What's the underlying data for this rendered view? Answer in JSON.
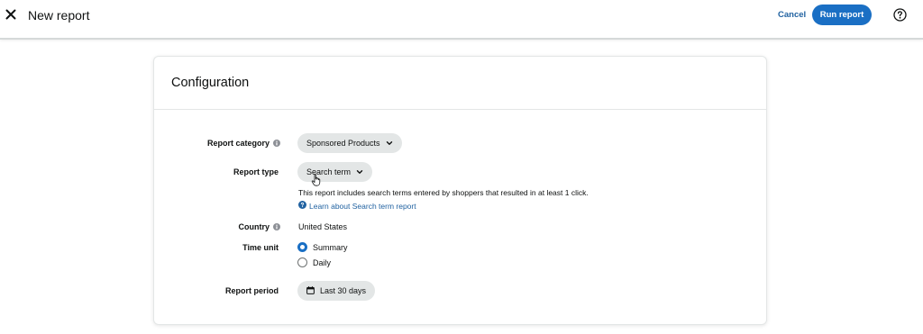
{
  "header": {
    "title": "New report",
    "cancel_label": "Cancel",
    "run_label": "Run report"
  },
  "card": {
    "title": "Configuration"
  },
  "fields": {
    "report_category": {
      "label": "Report category",
      "value": "Sponsored Products"
    },
    "report_type": {
      "label": "Report type",
      "value": "Search term",
      "description": "This report includes search terms entered by shoppers that resulted in at least 1 click.",
      "learn_link": "Learn about Search term report"
    },
    "country": {
      "label": "Country",
      "value": "United States"
    },
    "time_unit": {
      "label": "Time unit",
      "options": [
        "Summary",
        "Daily"
      ],
      "selected": "Summary"
    },
    "report_period": {
      "label": "Report period",
      "value": "Last 30 days"
    }
  },
  "colors": {
    "accent": "#1a6fc4",
    "link": "#2162a1",
    "pill_bg": "#e3e6e6"
  }
}
